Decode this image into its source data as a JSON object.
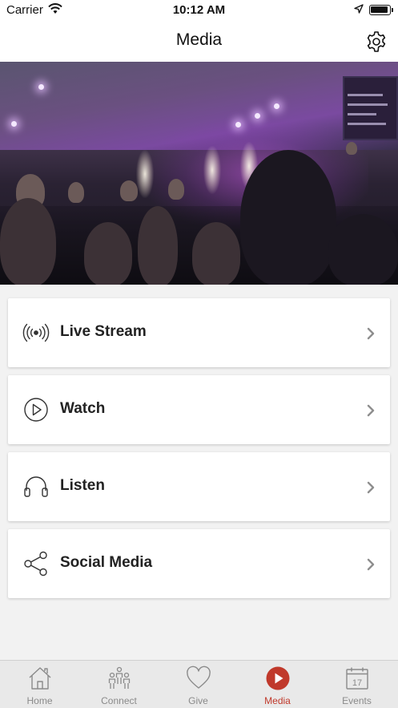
{
  "status_bar": {
    "carrier": "Carrier",
    "time": "10:12 AM"
  },
  "nav": {
    "title": "Media",
    "settings_icon": "gear-icon"
  },
  "hero": {
    "alt": "worship-service-photo"
  },
  "menu_items": [
    {
      "label": "Live Stream",
      "icon": "broadcast-icon"
    },
    {
      "label": "Watch",
      "icon": "play-circle-icon"
    },
    {
      "label": "Listen",
      "icon": "headphones-icon"
    },
    {
      "label": "Social Media",
      "icon": "share-icon"
    }
  ],
  "tabs": [
    {
      "label": "Home",
      "icon": "home-icon",
      "active": false
    },
    {
      "label": "Connect",
      "icon": "people-icon",
      "active": false
    },
    {
      "label": "Give",
      "icon": "heart-icon",
      "active": false
    },
    {
      "label": "Media",
      "icon": "play-circle-icon",
      "active": true
    },
    {
      "label": "Events",
      "icon": "calendar-icon",
      "active": false,
      "calendar_day": "17"
    }
  ],
  "colors": {
    "accent": "#c0392b",
    "tab_inactive": "#8a8a8a",
    "background": "#f2f2f2"
  }
}
